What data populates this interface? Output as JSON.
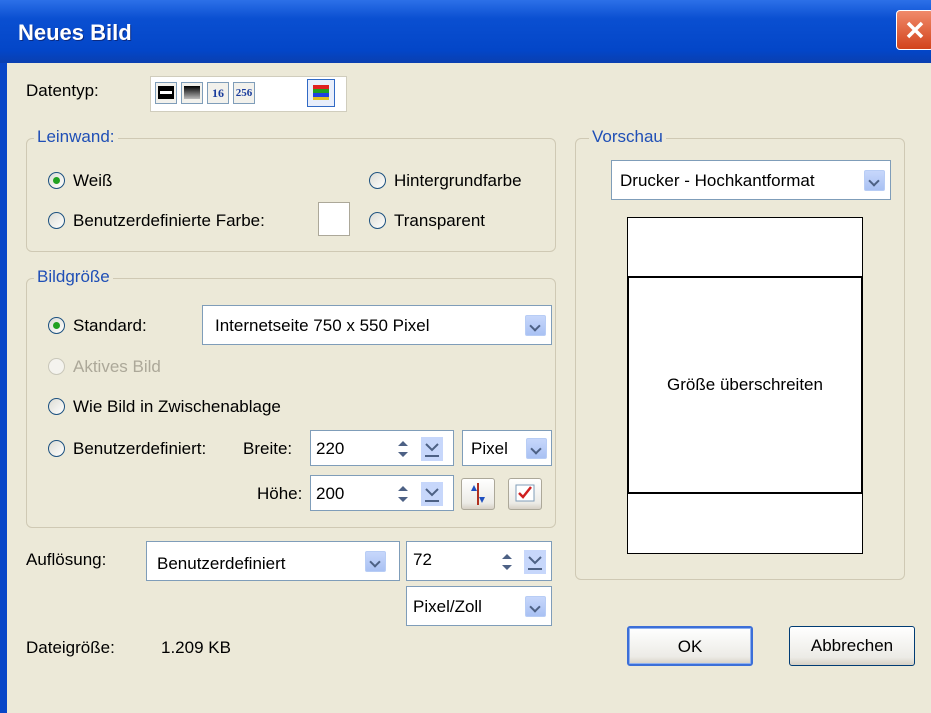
{
  "window": {
    "title": "Neues Bild"
  },
  "datentyp": {
    "label": "Datentyp:",
    "buttons": [
      "",
      "",
      "16",
      "256",
      ""
    ]
  },
  "leinwand": {
    "legend": "Leinwand:",
    "weiss": "Weiß",
    "hintergrund": "Hintergrundfarbe",
    "benutzerfarbe": "Benutzerdefinierte Farbe:",
    "transparent": "Transparent"
  },
  "bildgroesse": {
    "legend": "Bildgröße",
    "standard": "Standard:",
    "standard_value": "Internetseite 750 x 550 Pixel",
    "aktives": "Aktives Bild",
    "zwischenablage": "Wie Bild in Zwischenablage",
    "benutzerdefiniert": "Benutzerdefiniert:",
    "breite_label": "Breite:",
    "breite": "220",
    "hoehe_label": "Höhe:",
    "hoehe": "200",
    "einheit": "Pixel"
  },
  "aufloesung": {
    "label": "Auflösung:",
    "mode": "Benutzerdefiniert",
    "value": "72",
    "unit": "Pixel/Zoll"
  },
  "vorschau": {
    "legend": "Vorschau",
    "format": "Drucker - Hochkantformat",
    "message": "Größe überschreiten"
  },
  "dateigroesse": {
    "label": "Dateigröße:",
    "value": "1.209 KB"
  },
  "buttons": {
    "ok": "OK",
    "cancel": "Abbrechen"
  }
}
